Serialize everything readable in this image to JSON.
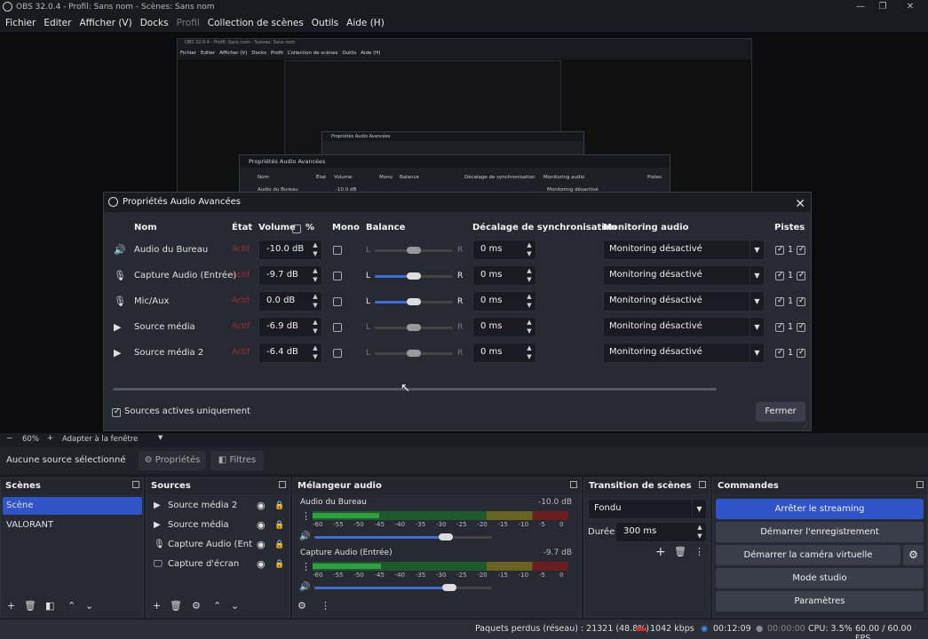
{
  "window": {
    "title": "OBS 32.0.4 - Profil: Sans nom - Scènes: Sans nom",
    "min": "—",
    "max": "❐",
    "close": "✕"
  },
  "menu": [
    "Fichier",
    "Editer",
    "Afficher (V)",
    "Docks",
    "Profil",
    "Collection de scènes",
    "Outils",
    "Aide (H)"
  ],
  "nested": {
    "title": "OBS 32.0.4 - Profil: Sans nom - Scènes: Sans nom",
    "menu": [
      "Fichier",
      "Editer",
      "Afficher (V)",
      "Docks",
      "Profil",
      "Collection de scènes",
      "Outils",
      "Aide (H)"
    ],
    "dlg_title": "Propriétés Audio Avancées",
    "dlg_hdr": [
      "Nom",
      "État",
      "Volume",
      "%",
      "Mono",
      "Balance",
      "Décalage de synchronisation",
      "Monitoring audio",
      "Pistes"
    ],
    "dlg_row": "Audio du Bureau",
    "dlg_vol": "-10.0 dB",
    "dlg_mon": "Monitoring désactivé"
  },
  "dialog": {
    "title": "Propriétés Audio Avancées",
    "close": "✕",
    "headers": {
      "name": "Nom",
      "state": "État",
      "volume": "Volume",
      "pct": "%",
      "mono": "Mono",
      "balance": "Balance",
      "sync": "Décalage de synchronisation",
      "monitoring": "Monitoring audio",
      "tracks": "Pistes"
    },
    "rows": [
      {
        "icon": "speaker",
        "name": "Audio du Bureau",
        "state": "Actif",
        "volume": "-10.0 dB",
        "sync": "0 ms",
        "monitoring": "Monitoring désactivé",
        "active_balance": false,
        "track": "1"
      },
      {
        "icon": "mic",
        "name": "Capture Audio (Entrée)",
        "state": "Actif",
        "volume": "-9.7 dB",
        "sync": "0 ms",
        "monitoring": "Monitoring désactivé",
        "active_balance": true,
        "track": "1"
      },
      {
        "icon": "mic",
        "name": "Mic/Aux",
        "state": "Actif",
        "volume": "0.0 dB",
        "sync": "0 ms",
        "monitoring": "Monitoring désactivé",
        "active_balance": true,
        "track": "1"
      },
      {
        "icon": "play",
        "name": "Source média",
        "state": "Actif",
        "volume": "-6.9 dB",
        "sync": "0 ms",
        "monitoring": "Monitoring désactivé",
        "active_balance": false,
        "track": "1"
      },
      {
        "icon": "play",
        "name": "Source média 2",
        "state": "Actif",
        "volume": "-6.4 dB",
        "sync": "0 ms",
        "monitoring": "Monitoring désactivé",
        "active_balance": false,
        "track": "1"
      }
    ],
    "balance_l": "L",
    "balance_r": "R",
    "active_only": "Sources actives uniquement",
    "close_btn": "Fermer"
  },
  "zoom": {
    "minus": "−",
    "value": "60%",
    "plus": "+",
    "fit": "Adapter à la fenêtre"
  },
  "toolbar": {
    "no_source": "Aucune source sélectionné",
    "properties": "Propriétés",
    "filters": "Filtres"
  },
  "scenes": {
    "title": "Scènes",
    "items": [
      "Scène",
      "VALORANT"
    ]
  },
  "sources": {
    "title": "Sources",
    "items": [
      {
        "icon": "play",
        "name": "Source média 2"
      },
      {
        "icon": "play",
        "name": "Source média"
      },
      {
        "icon": "mic",
        "name": "Capture Audio (Entrée"
      },
      {
        "icon": "monitor",
        "name": "Capture d'écran"
      }
    ]
  },
  "mixer": {
    "title": "Mélangeur audio",
    "channels": [
      {
        "name": "Audio du Bureau",
        "db": "-10.0 dB",
        "level": 0.74
      },
      {
        "name": "Capture Audio (Entrée)",
        "db": "-9.7 dB",
        "level": 0.76
      }
    ],
    "scale": [
      "-60",
      "-55",
      "-50",
      "-45",
      "-40",
      "-35",
      "-30",
      "-25",
      "-20",
      "-15",
      "-10",
      "-5",
      "0"
    ]
  },
  "transition": {
    "title": "Transition de scènes",
    "type": "Fondu",
    "duration_label": "Durée",
    "duration": "300 ms"
  },
  "commands": {
    "title": "Commandes",
    "buttons": [
      "Arrêter le streaming",
      "Démarrer l'enregistrement",
      "Démarrer la caméra virtuelle",
      "Mode studio",
      "Paramètres"
    ]
  },
  "status": {
    "dropped": "Paquets perdus (réseau) : 21321 (48.8%)",
    "kbps": "1042 kbps",
    "stream_time": "00:12:09",
    "rec_time": "00:00:00",
    "cpu": "CPU: 3.5%",
    "fps": "60.00 / 60.00 FPS"
  },
  "colors": {
    "accent": "#2f54c8",
    "meter_green": "#2ea043",
    "meter_yellow": "#c8b42a",
    "meter_red": "#c83232",
    "state_red": "#c03030"
  }
}
